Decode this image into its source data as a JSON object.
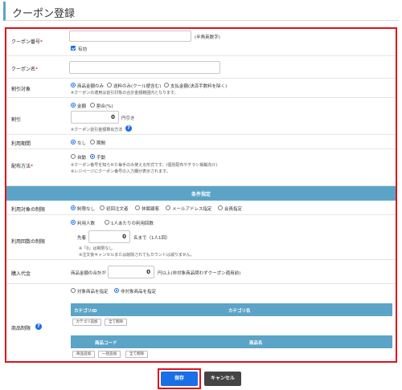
{
  "page": {
    "title": "クーポン登録"
  },
  "fields": {
    "coupon_code": {
      "label": "クーポン番号",
      "hint": "(半角英数字)",
      "active_label": "有効"
    },
    "coupon_name": {
      "label": "クーポン名"
    },
    "discount_target": {
      "label": "割引対象",
      "options": [
        "商品金額のみ",
        "送料のみ(クール便含む)",
        "支払金額(決済手数料を除く)"
      ],
      "selected": 0,
      "note": "※クーポンの適用は割引対象の合計金額範囲内となります。"
    },
    "discount": {
      "label": "割引",
      "options": [
        "金額",
        "割合(%)"
      ],
      "selected": 0,
      "value": "0",
      "unit": "円引き",
      "note": "※クーポン割引金額算出方法"
    },
    "period": {
      "label": "利用期間",
      "options": [
        "なし",
        "期間"
      ],
      "selected": 0
    },
    "distribution": {
      "label": "配布方法",
      "options": [
        "自動",
        "手動"
      ],
      "selected": 1,
      "note1": "※クーポン番号を知らせた毎手のみ使える形式です。(個別配布やチラシ掲載向け)",
      "note2": "※レジページにクーポン番号の入力欄が表示されます。"
    }
  },
  "conditions": {
    "title": "条件指定",
    "target_limit": {
      "label": "利用対象の制限",
      "options": [
        "制限なし",
        "初回注文者",
        "休眠顧客",
        "メールアドレス指定",
        "会員指定"
      ],
      "selected": 0
    },
    "usage_limit": {
      "label": "利用回数の制限",
      "options": [
        "利用人数",
        "1人あたりの利用回数"
      ],
      "selected": 0,
      "prefix": "先着",
      "value": "0",
      "unit": "名まで（1人1回）",
      "note1": "※「0」は制限なし",
      "note2": "※注文後キャンセルまたは削除されてもカウントは減りません。"
    },
    "purchase_amount": {
      "label": "購入代金",
      "prefix": "商品金額の合計が",
      "value": "0",
      "unit": "円以上(非対象商品問わずクーポン適用前)"
    },
    "product_limit": {
      "label": "商品制限",
      "options": [
        "対象商品を指定",
        "非対象商品を指定"
      ],
      "selected": 1,
      "category_table": {
        "col1": "カテゴリID",
        "col2": "カテゴリ名",
        "btn_add": "カテゴリ追加",
        "btn_delete": "全て削除"
      },
      "product_table": {
        "col1": "商品コード",
        "col2": "商品名",
        "btn_add": "商品追加",
        "btn_bulk": "一括追加",
        "btn_delete": "全て削除"
      }
    }
  },
  "footer": {
    "save_label": "保存",
    "cancel_label": "キャンセル"
  },
  "colors": {
    "accent_blue": "#1a6ee6",
    "header_teal": "#5ba4c7",
    "highlight_red": "#e0121a",
    "cancel_dark": "#444444"
  }
}
